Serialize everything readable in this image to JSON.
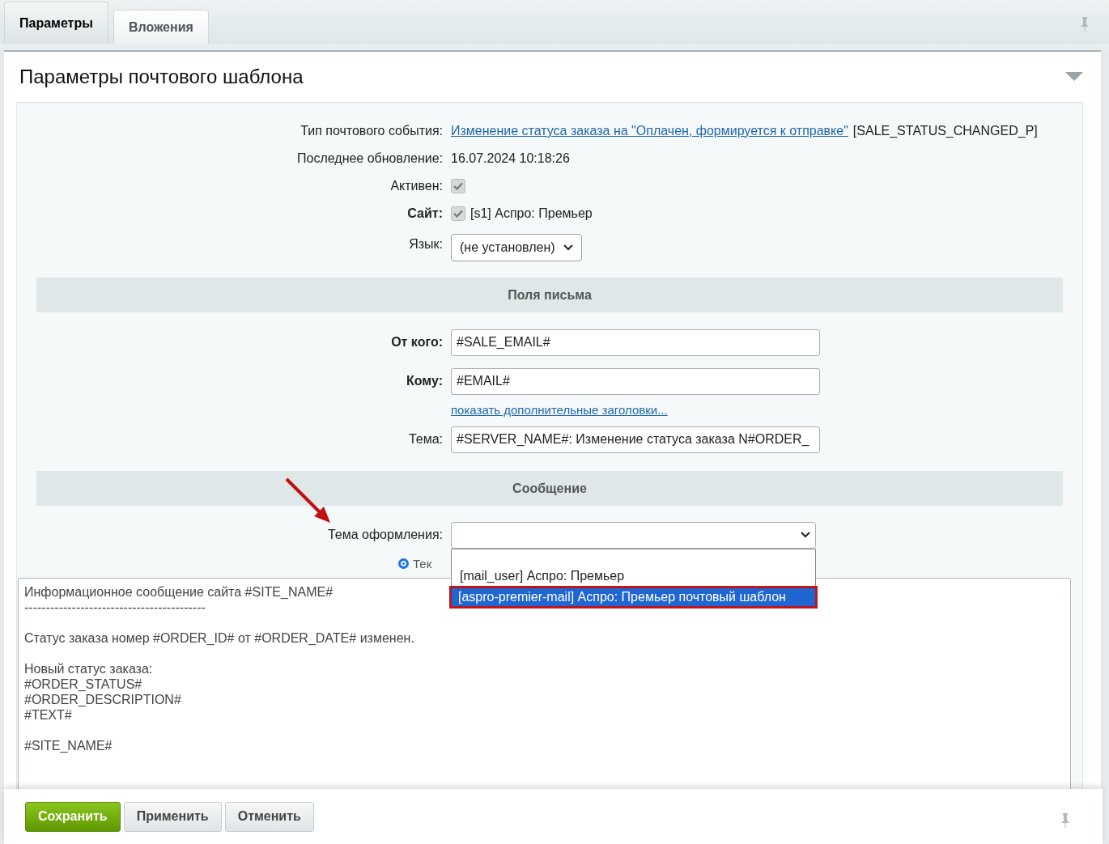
{
  "tabs": [
    {
      "label": "Параметры",
      "selected": true
    },
    {
      "label": "Вложения",
      "selected": false
    }
  ],
  "panel": {
    "title": "Параметры почтового шаблона"
  },
  "rows": [
    {
      "kind": "link",
      "label": "Тип почтового события:",
      "bold": false,
      "link": "Изменение статуса заказа на \"Оплачен, формируется к отправке\"",
      "code": "[SALE_STATUS_CHANGED_P]"
    },
    {
      "kind": "text",
      "label": "Последнее обновление:",
      "bold": false,
      "value": "16.07.2024 10:18:26"
    },
    {
      "kind": "checkbox",
      "label": "Активен:",
      "bold": false,
      "checked": true
    },
    {
      "kind": "checkbox",
      "label": "Сайт:",
      "bold": true,
      "checked": true,
      "text": "[s1] Аспро: Премьер"
    },
    {
      "kind": "select",
      "label": "Язык:",
      "bold": false,
      "value": "(не установлен)"
    }
  ],
  "sections": [
    {
      "title": "Поля письма",
      "rows": [
        {
          "kind": "input",
          "label": "От кого:",
          "bold": true,
          "value": "#SALE_EMAIL#"
        },
        {
          "kind": "input",
          "label": "Кому:",
          "bold": true,
          "value": "#EMAIL#"
        },
        {
          "kind": "link_only",
          "link": "показать дополнительные заголовки..."
        },
        {
          "kind": "input",
          "label": "Тема:",
          "bold": false,
          "value": "#SERVER_NAME#: Изменение статуса заказа N#ORDER_"
        }
      ]
    },
    {
      "title": "Сообщение"
    }
  ],
  "theme": {
    "label": "Тема оформления:",
    "open": true,
    "options": [
      {
        "label": "[mail_user] Аспро: Премьер",
        "selected": false
      },
      {
        "label": "[aspro-premier-mail] Аспро: Премьер почтовый шаблон",
        "selected": true
      }
    ]
  },
  "format_radio": {
    "label": "Тек",
    "selected": true
  },
  "message": {
    "paragraphs": [
      [
        "Информационное сообщение сайта #SITE_NAME#",
        "------------------------------------------"
      ],
      [
        "Статус заказа номер #ORDER_ID# от #ORDER_DATE# изменен."
      ],
      [
        "Новый статус заказа:",
        "#ORDER_STATUS#",
        "#ORDER_DESCRIPTION#",
        "#TEXT#"
      ],
      [
        "#SITE_NAME#"
      ]
    ]
  },
  "buttons": [
    {
      "label": "Сохранить",
      "kind": "primary"
    },
    {
      "label": "Применить",
      "kind": "default"
    },
    {
      "label": "Отменить",
      "kind": "default"
    }
  ]
}
